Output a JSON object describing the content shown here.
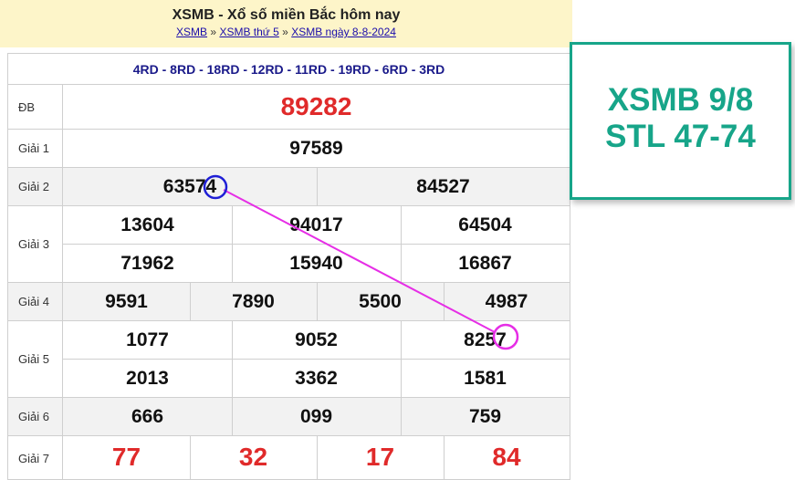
{
  "header": {
    "title": "XSMB - Xổ số miền Bắc hôm nay",
    "breadcrumb": [
      "XSMB",
      "XSMB thứ 5",
      "XSMB ngày 8-8-2024"
    ],
    "separator": "»"
  },
  "codes": "4RD - 8RD - 18RD - 12RD - 11RD - 19RD - 6RD - 3RD",
  "prizes": {
    "db": {
      "label": "ĐB",
      "numbers": [
        "89282"
      ]
    },
    "g1": {
      "label": "Giải 1",
      "numbers": [
        "97589"
      ]
    },
    "g2": {
      "label": "Giải 2",
      "numbers": [
        "63574",
        "84527"
      ]
    },
    "g3": {
      "label": "Giải 3",
      "numbers": [
        "13604",
        "94017",
        "64504",
        "71962",
        "15940",
        "16867"
      ]
    },
    "g4": {
      "label": "Giải 4",
      "numbers": [
        "9591",
        "7890",
        "5500",
        "4987"
      ]
    },
    "g5": {
      "label": "Giải 5",
      "numbers": [
        "1077",
        "9052",
        "8257",
        "2013",
        "3362",
        "1581"
      ]
    },
    "g6": {
      "label": "Giải 6",
      "numbers": [
        "666",
        "099",
        "759"
      ]
    },
    "g7": {
      "label": "Giải 7",
      "numbers": [
        "77",
        "32",
        "17",
        "84"
      ]
    }
  },
  "callout": {
    "line1": "XSMB 9/8",
    "line2": "STL 47-74"
  },
  "colors": {
    "accent": "#17a589",
    "red": "#e02a2a",
    "connector": "#e62ee6",
    "circle_blue": "#1f1fd6"
  }
}
